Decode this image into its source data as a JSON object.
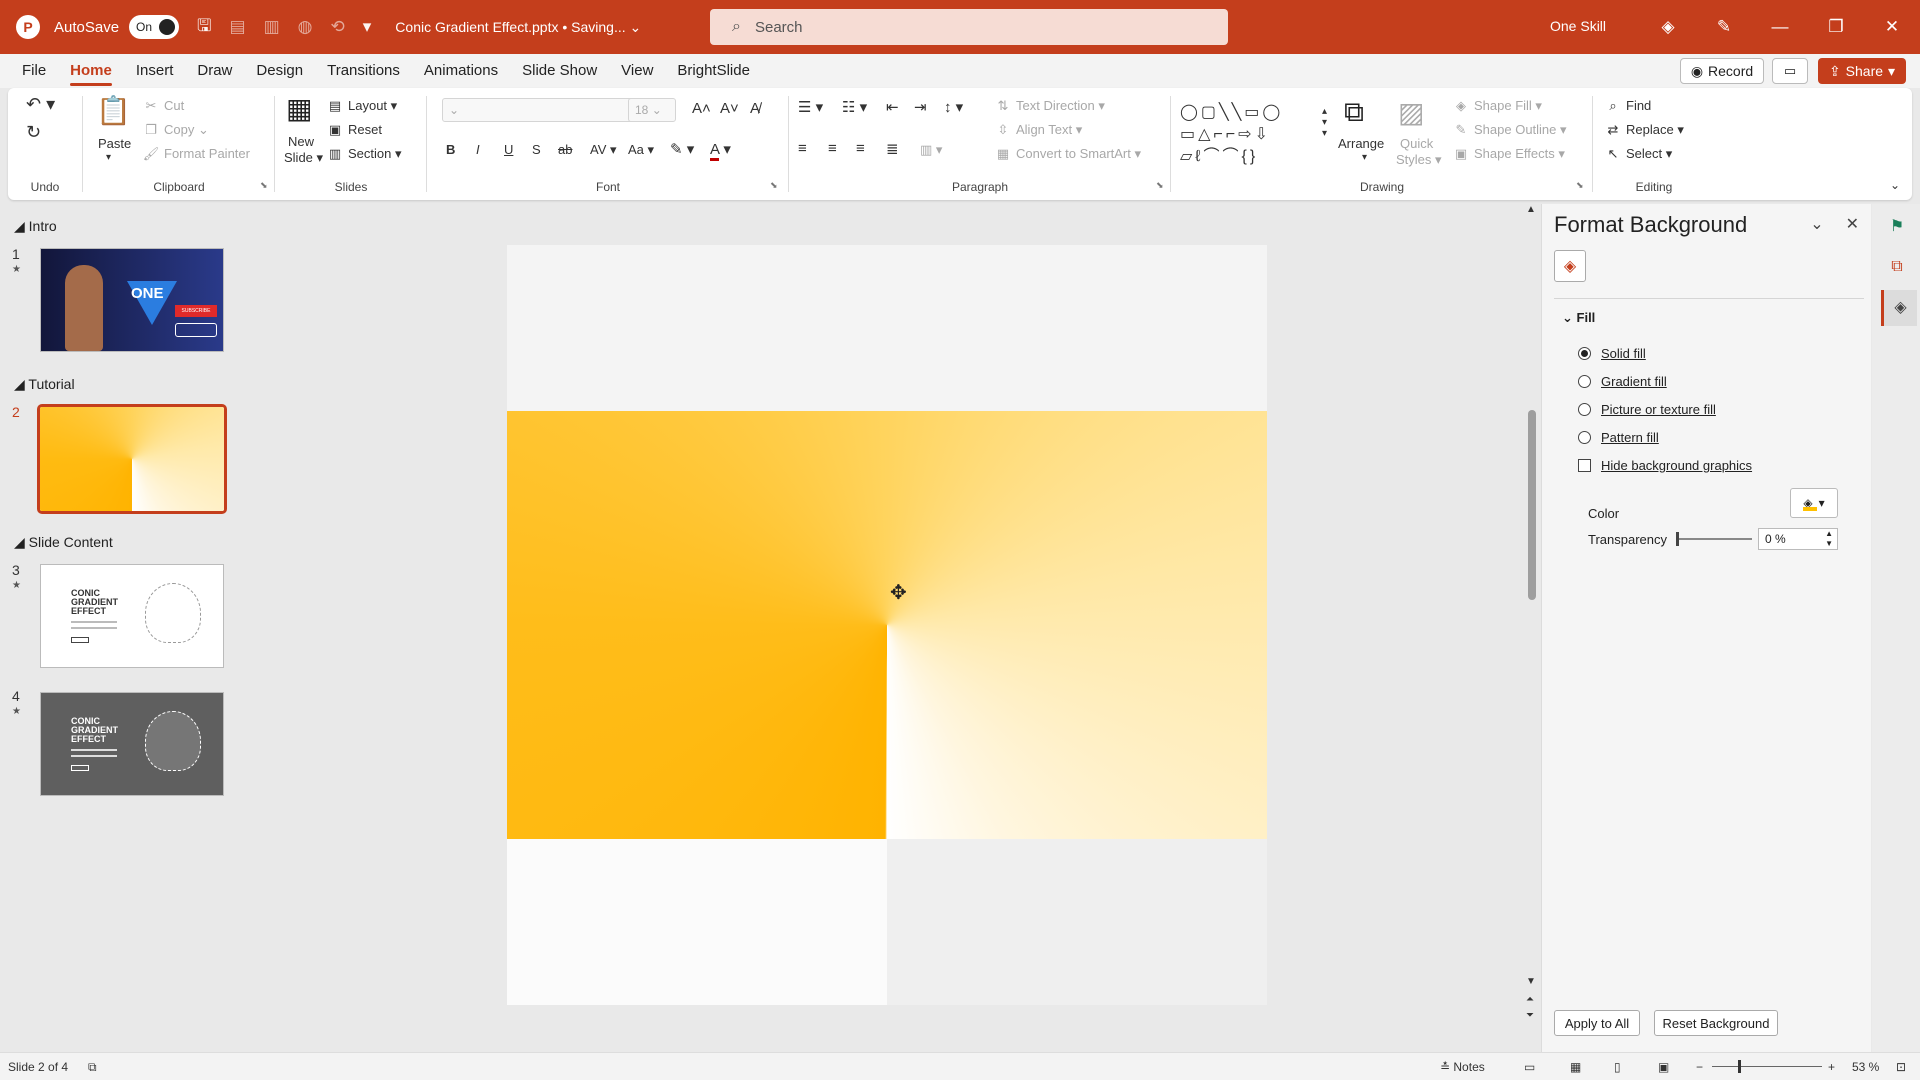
{
  "titlebar": {
    "logo": "P",
    "autosave_label": "AutoSave",
    "autosave_state": "On",
    "filename": "Conic Gradient Effect.pptx • Saving... ⌄",
    "search_placeholder": "Search",
    "user": "One Skill"
  },
  "menu": {
    "tabs": [
      "File",
      "Home",
      "Insert",
      "Draw",
      "Design",
      "Transitions",
      "Animations",
      "Slide Show",
      "View",
      "BrightSlide"
    ],
    "active": "Home",
    "record": "Record",
    "share": "Share"
  },
  "ribbon": {
    "undo": "Undo",
    "clipboard": {
      "label": "Clipboard",
      "paste": "Paste",
      "cut": "Cut",
      "copy": "Copy",
      "format_painter": "Format Painter"
    },
    "slides": {
      "label": "Slides",
      "new_slide_1": "New",
      "new_slide_2": "Slide",
      "layout": "Layout",
      "reset": "Reset",
      "section": "Section"
    },
    "font": {
      "label": "Font",
      "size": "18"
    },
    "paragraph": {
      "label": "Paragraph",
      "text_direction": "Text Direction",
      "align_text": "Align Text",
      "convert_smartart": "Convert to SmartArt"
    },
    "drawing": {
      "label": "Drawing",
      "arrange": "Arrange",
      "quick_styles_1": "Quick",
      "quick_styles_2": "Styles",
      "shape_fill": "Shape Fill",
      "shape_outline": "Shape Outline",
      "shape_effects": "Shape Effects"
    },
    "editing": {
      "label": "Editing",
      "find": "Find",
      "replace": "Replace",
      "select": "Select"
    }
  },
  "slide_pane": {
    "sections": [
      "Intro",
      "Tutorial",
      "Slide Content"
    ],
    "slides": [
      {
        "num": "1",
        "sub": "ONE",
        "sub2": "SUBSCRIBE"
      },
      {
        "num": "2"
      },
      {
        "num": "3",
        "title": "CONIC GRADIENT EFFECT"
      },
      {
        "num": "4",
        "title": "CONIC GRADIENT EFFECT"
      }
    ],
    "active": "2"
  },
  "format_pane": {
    "title": "Format Background",
    "section": "Fill",
    "options": [
      "Solid fill",
      "Gradient fill",
      "Picture or texture fill",
      "Pattern fill"
    ],
    "selected": "Solid fill",
    "hide_bg": "Hide background graphics",
    "color_label": "Color",
    "transparency_label": "Transparency",
    "transparency_value": "0 %",
    "transparency_fraction": 0,
    "apply_all": "Apply to All",
    "reset_bg": "Reset Background"
  },
  "status": {
    "slide_info": "Slide 2 of 4",
    "notes": "Notes",
    "zoom": "53 %"
  },
  "colors": {
    "accent": "#c43e1c",
    "gradient_warm": "#ffb300",
    "gradient_light": "#fff6df",
    "fill_color": "#ffc000"
  }
}
